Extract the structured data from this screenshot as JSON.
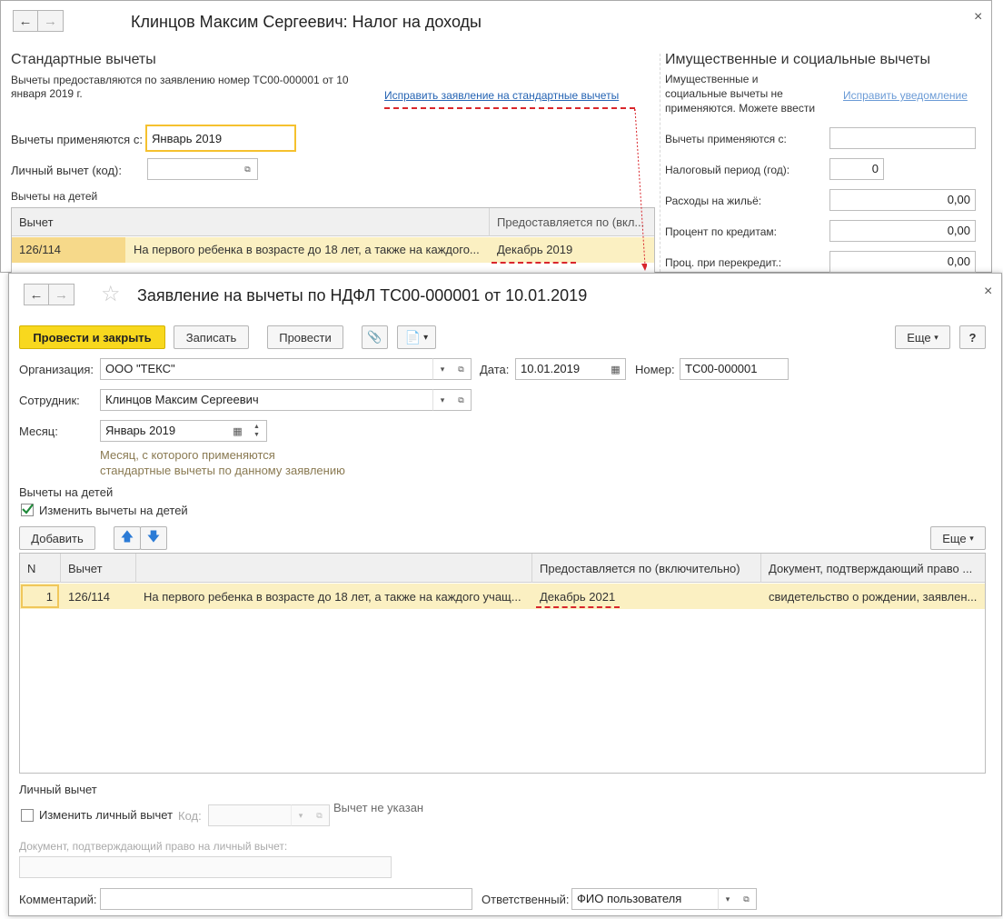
{
  "back_window": {
    "title": "Клинцов Максим Сергеевич: Налог на доходы",
    "standard": {
      "heading": "Стандартные вычеты",
      "note_line1": "Вычеты предоставляются по заявлению номер ТС00-000001 от 10",
      "note_line2": "января 2019 г.",
      "fix_link": "Исправить заявление на стандартные вычеты",
      "apply_from_label": "Вычеты применяются с:",
      "apply_from_value": "Январь 2019",
      "personal_label": "Личный вычет (код):",
      "personal_value": "",
      "children_heading": "Вычеты на детей",
      "grid": {
        "col_deduction": "Вычет",
        "col_until": "Предоставляется по (вкл...",
        "row": {
          "code": "126/114",
          "description": "На первого ребенка в возрасте до 18 лет, а также на каждого...",
          "until": "Декабрь 2019"
        }
      }
    },
    "property": {
      "heading": "Имущественные и социальные вычеты",
      "note_line1": "Имущественные и",
      "note_line2": "социальные вычеты не",
      "note_line3": "применяются. Можете ввести",
      "fix_link": "Исправить уведомление",
      "fields": [
        {
          "label": "Вычеты применяются с:",
          "value": ""
        },
        {
          "label": "Налоговый период (год):",
          "value": "0"
        },
        {
          "label": "Расходы на жильё:",
          "value": "0,00"
        },
        {
          "label": "Процент по кредитам:",
          "value": "0,00"
        },
        {
          "label": "Проц. при перекредит.:",
          "value": "0,00"
        }
      ]
    }
  },
  "front_window": {
    "title": "Заявление на вычеты по НДФЛ ТС00-000001 от 10.01.2019",
    "toolbar": {
      "post_close": "Провести и закрыть",
      "save": "Записать",
      "post": "Провести",
      "more": "Еще",
      "help": "?"
    },
    "organization_label": "Организация:",
    "organization_value": "ООО \"ТЕКС\"",
    "date_label": "Дата:",
    "date_value": "10.01.2019",
    "number_label": "Номер:",
    "number_value": "ТС00-000001",
    "employee_label": "Сотрудник:",
    "employee_value": "Клинцов Максим Сергеевич",
    "month_label": "Месяц:",
    "month_value": "Январь 2019",
    "month_hint_line1": "Месяц, с которого применяются",
    "month_hint_line2": "стандартные вычеты по данному заявлению",
    "children": {
      "heading": "Вычеты на детей",
      "change_checkbox_label": "Изменить вычеты на детей",
      "change_checked": true,
      "add_button": "Добавить",
      "more_button": "Еще",
      "columns": [
        "N",
        "Вычет",
        "",
        "Предоставляется по (включительно)",
        "Документ, подтверждающий право ..."
      ],
      "rows": [
        {
          "n": "1",
          "code": "126/114",
          "description": "На первого ребенка в возрасте до 18 лет, а также на каждого учащ...",
          "until": "Декабрь 2021",
          "document": "свидетельство о рождении, заявлен..."
        }
      ]
    },
    "personal": {
      "heading": "Личный вычет",
      "change_checkbox_label": "Изменить личный вычет",
      "change_checked": false,
      "code_label": "Код:",
      "code_value": "",
      "not_specified": "Вычет не указан",
      "doc_label": "Документ, подтверждающий право на личный вычет:",
      "doc_value": ""
    },
    "comment_label": "Комментарий:",
    "comment_value": "",
    "responsible_label": "Ответственный:",
    "responsible_value": "ФИО пользователя"
  }
}
